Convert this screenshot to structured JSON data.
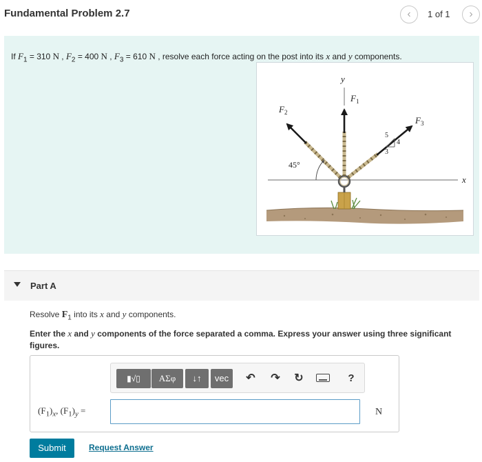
{
  "header": {
    "title": "Fundamental Problem 2.7",
    "prev_icon": "chevron-left-icon",
    "prev_glyph": "‹",
    "next_icon": "chevron-right-icon",
    "next_glyph": "›",
    "page_indicator": "1 of 1"
  },
  "problem": {
    "statement": {
      "if": "If ",
      "f1_sym": "F",
      "f1_sub": "1",
      "f1_eq": " = 310 ",
      "f1_unit": "N",
      "sep1": " , ",
      "f2_sym": "F",
      "f2_sub": "2",
      "f2_eq": " = 400 ",
      "f2_unit": "N",
      "sep2": " , ",
      "f3_sym": "F",
      "f3_sub": "3",
      "f3_eq": " = 610 ",
      "f3_unit": "N",
      "text_a": " , resolve each force acting on the post into its ",
      "x_sym": "x",
      "text_b": " and ",
      "y_sym": "y",
      "text_c": " components."
    },
    "figure": {
      "y_axis_label": "y",
      "x_axis_label": "x",
      "f1_label": "F",
      "f1_sub": "1",
      "f2_label": "F",
      "f2_sub": "2",
      "f3_label": "F",
      "f3_sub": "3",
      "angle_label": "45°",
      "slope_hyp": "5",
      "slope_rise": "4",
      "slope_run": "3",
      "colors": {
        "arrow": "#1a1a1a",
        "ground": "#b49a7c",
        "post": "#c9a24a",
        "grass": "#5a8a3c",
        "cable": "#c8b88f"
      }
    }
  },
  "part_a": {
    "title": "Part A",
    "resolve": {
      "text_a": "Resolve ",
      "force_sym": "F",
      "force_sub": "1",
      "text_b": " into its ",
      "x_sym": "x",
      "text_c": " and ",
      "y_sym": "y",
      "text_d": " components."
    },
    "instructions": {
      "text_a": "Enter the ",
      "x_sym": "x",
      "text_b": " and ",
      "y_sym": "y",
      "text_c": " components of the force separated a comma. Express your answer using three significant figures."
    },
    "toolbar": {
      "templates_icon": "math-templates-icon",
      "templates_glyph": "▮√▯",
      "symbols_label": "ΑΣφ",
      "arrows_label": "↓↑",
      "vec_label": "vec",
      "undo_icon": "undo-icon",
      "undo_glyph": "↶",
      "redo_icon": "redo-icon",
      "redo_glyph": "↷",
      "reset_icon": "reset-icon",
      "reset_glyph": "↻",
      "keyboard_icon": "keyboard-icon",
      "help_icon": "help-icon",
      "help_glyph": "?"
    },
    "answer": {
      "label_p1": "(F",
      "label_s1": "1",
      "label_p2": ")",
      "label_s2": "x",
      "label_p3": ", (F",
      "label_s3": "1",
      "label_p4": ")",
      "label_s4": "y",
      "label_eq": " =",
      "value": "",
      "unit": "N"
    },
    "submit_label": "Submit",
    "request_label": "Request Answer"
  }
}
